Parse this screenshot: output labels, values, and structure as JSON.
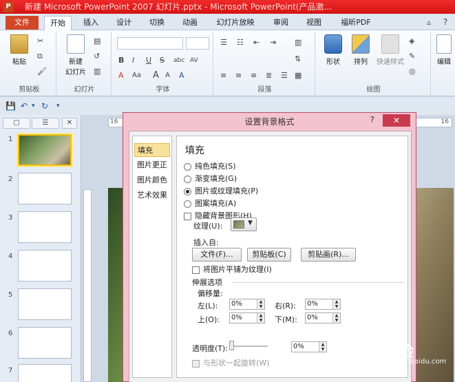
{
  "titlebar": {
    "app_icon": "P",
    "title": "新建 Microsoft PowerPoint 2007 幻灯片.pptx - Microsoft PowerPoint(产品激..."
  },
  "tabs": {
    "file": "文件",
    "items": [
      "开始",
      "插入",
      "设计",
      "切换",
      "动画",
      "幻灯片放映",
      "审阅",
      "视图",
      "福昕PDF"
    ]
  },
  "ribbon": {
    "clipboard": {
      "paste": "粘贴",
      "label": "剪贴板"
    },
    "slides": {
      "new_slide": "新建",
      "new_slide_2": "幻灯片",
      "label": "幻灯片"
    },
    "font": {
      "label": "字体",
      "bold": "B",
      "italic": "I",
      "underline": "U",
      "strike": "S",
      "shadow": "abc",
      "spacing": "AV",
      "size_up": "A",
      "size_down": "A",
      "case": "Aa",
      "color": "A",
      "clear": "A"
    },
    "paragraph": {
      "label": "段落"
    },
    "drawing": {
      "shapes": "形状",
      "arrange": "排列",
      "quick_styles": "快速样式",
      "label": "绘图"
    },
    "editing": {
      "label": "编辑"
    }
  },
  "slides_pane": {
    "thumbnails": [
      "1",
      "2",
      "3",
      "4",
      "5",
      "6",
      "7"
    ]
  },
  "ruler": {
    "left_mark": "16",
    "right_mark": "16"
  },
  "dialog": {
    "title": "设置背景格式",
    "help": "?",
    "close": "✕",
    "nav": [
      "填充",
      "图片更正",
      "图片颜色",
      "艺术效果"
    ],
    "panel": {
      "section_title": "填充",
      "fill_options": [
        {
          "label": "纯色填充(S)",
          "checked": false
        },
        {
          "label": "渐变填充(G)",
          "checked": false
        },
        {
          "label": "图片或纹理填充(P)",
          "checked": true
        },
        {
          "label": "图案填充(A)",
          "checked": false
        }
      ],
      "hide_bg": "隐藏背景图形(H)",
      "texture_label": "纹理(U):",
      "insert_from": "插入自:",
      "buttons": {
        "file": "文件(F)...",
        "clipboard": "剪贴板(C)",
        "clipart": "剪贴画(R)..."
      },
      "tile_checkbox": "将图片平铺为纹理(I)",
      "stretch_options": "伸展选项",
      "offset": "偏移量:",
      "left_label": "左(L):",
      "left_value": "0%",
      "right_label": "右(R):",
      "right_value": "0%",
      "top_label": "上(O):",
      "top_value": "0%",
      "bottom_label": "下(M):",
      "bottom_value": "0%",
      "transparency_label": "透明度(T):",
      "transparency_value": "0%",
      "rotate_with_shape": "与形状一起旋转(W)"
    }
  },
  "watermark": {
    "text": "Bai 经验",
    "sub": "jingyan.baidu.com"
  }
}
